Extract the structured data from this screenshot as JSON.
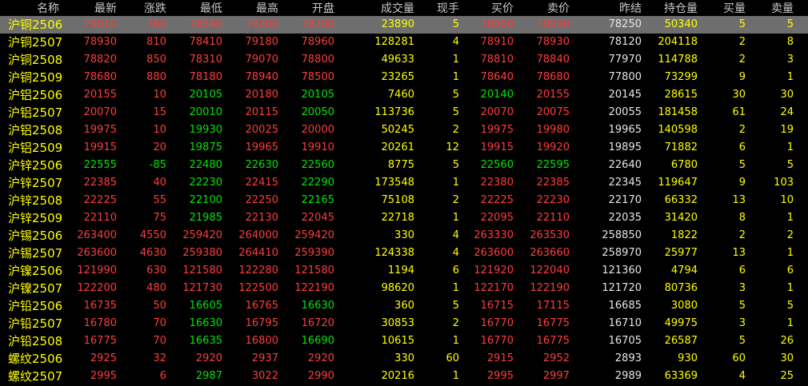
{
  "columns": [
    "名称",
    "最新",
    "涨跌",
    "最低",
    "最高",
    "开盘",
    "成交量",
    "现手",
    "买价",
    "卖价",
    "昨结",
    "持仓量",
    "买量",
    "卖量"
  ],
  "colors": {
    "up": "#ff3c3c",
    "down": "#00e600",
    "yellow": "#ffff00",
    "white": "#e6e6e6",
    "selected_row": "#6e6e6e"
  },
  "rows": [
    [
      "沪铜2506",
      "79010",
      "760",
      "78540",
      "79200",
      "78700",
      "23890",
      "5",
      "78990",
      "79030",
      "78250",
      "50340",
      "5",
      "5"
    ],
    [
      "沪铜2507",
      "78930",
      "810",
      "78410",
      "79180",
      "78960",
      "128281",
      "4",
      "78910",
      "78930",
      "78120",
      "204118",
      "2",
      "8"
    ],
    [
      "沪铜2508",
      "78820",
      "850",
      "78310",
      "79070",
      "78800",
      "49633",
      "1",
      "78810",
      "78840",
      "77970",
      "114788",
      "2",
      "3"
    ],
    [
      "沪铜2509",
      "78680",
      "880",
      "78180",
      "78940",
      "78500",
      "23265",
      "1",
      "78640",
      "78680",
      "77800",
      "73299",
      "9",
      "1"
    ],
    [
      "沪铝2506",
      "20155",
      "10",
      "20105",
      "20180",
      "20105",
      "7460",
      "5",
      "20140",
      "20155",
      "20145",
      "28615",
      "30",
      "30"
    ],
    [
      "沪铝2507",
      "20070",
      "15",
      "20010",
      "20115",
      "20050",
      "113736",
      "5",
      "20070",
      "20075",
      "20055",
      "181458",
      "61",
      "24"
    ],
    [
      "沪铝2508",
      "19975",
      "10",
      "19930",
      "20025",
      "20000",
      "50245",
      "2",
      "19975",
      "19980",
      "19965",
      "140598",
      "2",
      "19"
    ],
    [
      "沪铝2509",
      "19915",
      "20",
      "19875",
      "19965",
      "19910",
      "20261",
      "12",
      "19915",
      "19920",
      "19895",
      "71882",
      "6",
      "1"
    ],
    [
      "沪锌2506",
      "22555",
      "-85",
      "22480",
      "22630",
      "22560",
      "8775",
      "5",
      "22560",
      "22595",
      "22640",
      "6780",
      "5",
      "5"
    ],
    [
      "沪锌2507",
      "22385",
      "40",
      "22230",
      "22415",
      "22290",
      "173548",
      "1",
      "22380",
      "22385",
      "22345",
      "119647",
      "9",
      "103"
    ],
    [
      "沪锌2508",
      "22225",
      "55",
      "22100",
      "22250",
      "22165",
      "75108",
      "2",
      "22225",
      "22230",
      "22170",
      "66332",
      "13",
      "10"
    ],
    [
      "沪锌2509",
      "22110",
      "75",
      "21985",
      "22130",
      "22045",
      "22718",
      "1",
      "22095",
      "22110",
      "22035",
      "31420",
      "8",
      "1"
    ],
    [
      "沪锡2506",
      "263400",
      "4550",
      "259420",
      "264000",
      "259420",
      "330",
      "4",
      "263330",
      "263530",
      "258850",
      "1822",
      "2",
      "2"
    ],
    [
      "沪锡2507",
      "263600",
      "4630",
      "259380",
      "264410",
      "259390",
      "124338",
      "4",
      "263600",
      "263660",
      "258970",
      "25977",
      "13",
      "1"
    ],
    [
      "沪镍2506",
      "121990",
      "630",
      "121580",
      "122280",
      "121580",
      "1194",
      "6",
      "121920",
      "122040",
      "121360",
      "4794",
      "6",
      "6"
    ],
    [
      "沪镍2507",
      "122200",
      "480",
      "121730",
      "122500",
      "122190",
      "98620",
      "1",
      "122170",
      "122190",
      "121720",
      "80736",
      "3",
      "1"
    ],
    [
      "沪铅2506",
      "16735",
      "50",
      "16605",
      "16765",
      "16630",
      "360",
      "5",
      "16715",
      "17115",
      "16685",
      "3080",
      "5",
      "5"
    ],
    [
      "沪铅2507",
      "16780",
      "70",
      "16630",
      "16795",
      "16720",
      "30853",
      "2",
      "16770",
      "16775",
      "16710",
      "49975",
      "3",
      "1"
    ],
    [
      "沪铅2508",
      "16775",
      "70",
      "16635",
      "16800",
      "16690",
      "10615",
      "1",
      "16770",
      "16775",
      "16705",
      "26587",
      "5",
      "26"
    ],
    [
      "螺纹2506",
      "2925",
      "32",
      "2920",
      "2937",
      "2920",
      "330",
      "60",
      "2915",
      "2952",
      "2893",
      "930",
      "60",
      "30"
    ],
    [
      "螺纹2507",
      "2995",
      "6",
      "2987",
      "3022",
      "2990",
      "20216",
      "1",
      "2995",
      "2997",
      "2989",
      "63369",
      "4",
      "25"
    ]
  ],
  "cell_colors": [
    [
      "yel",
      "up",
      "up",
      "up",
      "up",
      "up",
      "yel",
      "yel",
      "up",
      "up",
      "wht",
      "yel",
      "yel",
      "yel"
    ],
    [
      "yel",
      "up",
      "up",
      "up",
      "up",
      "up",
      "yel",
      "yel",
      "up",
      "up",
      "wht",
      "yel",
      "yel",
      "yel"
    ],
    [
      "yel",
      "up",
      "up",
      "up",
      "up",
      "up",
      "yel",
      "yel",
      "up",
      "up",
      "wht",
      "yel",
      "yel",
      "yel"
    ],
    [
      "yel",
      "up",
      "up",
      "up",
      "up",
      "up",
      "yel",
      "yel",
      "up",
      "up",
      "wht",
      "yel",
      "yel",
      "yel"
    ],
    [
      "yel",
      "up",
      "up",
      "down",
      "up",
      "down",
      "yel",
      "yel",
      "down",
      "up",
      "wht",
      "yel",
      "yel",
      "yel"
    ],
    [
      "yel",
      "up",
      "up",
      "down",
      "up",
      "down",
      "yel",
      "yel",
      "up",
      "up",
      "wht",
      "yel",
      "yel",
      "yel"
    ],
    [
      "yel",
      "up",
      "up",
      "down",
      "up",
      "up",
      "yel",
      "yel",
      "up",
      "up",
      "wht",
      "yel",
      "yel",
      "yel"
    ],
    [
      "yel",
      "up",
      "up",
      "down",
      "up",
      "up",
      "yel",
      "yel",
      "up",
      "up",
      "wht",
      "yel",
      "yel",
      "yel"
    ],
    [
      "yel",
      "down",
      "down",
      "down",
      "down",
      "down",
      "yel",
      "yel",
      "down",
      "down",
      "wht",
      "yel",
      "yel",
      "yel"
    ],
    [
      "yel",
      "up",
      "up",
      "down",
      "up",
      "down",
      "yel",
      "yel",
      "up",
      "up",
      "wht",
      "yel",
      "yel",
      "yel"
    ],
    [
      "yel",
      "up",
      "up",
      "down",
      "up",
      "down",
      "yel",
      "yel",
      "up",
      "up",
      "wht",
      "yel",
      "yel",
      "yel"
    ],
    [
      "yel",
      "up",
      "up",
      "down",
      "up",
      "up",
      "yel",
      "yel",
      "up",
      "up",
      "wht",
      "yel",
      "yel",
      "yel"
    ],
    [
      "yel",
      "up",
      "up",
      "up",
      "up",
      "up",
      "yel",
      "yel",
      "up",
      "up",
      "wht",
      "yel",
      "yel",
      "yel"
    ],
    [
      "yel",
      "up",
      "up",
      "up",
      "up",
      "up",
      "yel",
      "yel",
      "up",
      "up",
      "wht",
      "yel",
      "yel",
      "yel"
    ],
    [
      "yel",
      "up",
      "up",
      "up",
      "up",
      "up",
      "yel",
      "yel",
      "up",
      "up",
      "wht",
      "yel",
      "yel",
      "yel"
    ],
    [
      "yel",
      "up",
      "up",
      "up",
      "up",
      "up",
      "yel",
      "yel",
      "up",
      "up",
      "wht",
      "yel",
      "yel",
      "yel"
    ],
    [
      "yel",
      "up",
      "up",
      "down",
      "up",
      "down",
      "yel",
      "yel",
      "up",
      "up",
      "wht",
      "yel",
      "yel",
      "yel"
    ],
    [
      "yel",
      "up",
      "up",
      "down",
      "up",
      "up",
      "yel",
      "yel",
      "up",
      "up",
      "wht",
      "yel",
      "yel",
      "yel"
    ],
    [
      "yel",
      "up",
      "up",
      "down",
      "up",
      "down",
      "yel",
      "yel",
      "up",
      "up",
      "wht",
      "yel",
      "yel",
      "yel"
    ],
    [
      "yel",
      "up",
      "up",
      "up",
      "up",
      "up",
      "yel",
      "yel",
      "up",
      "up",
      "wht",
      "yel",
      "yel",
      "yel"
    ],
    [
      "yel",
      "up",
      "up",
      "down",
      "up",
      "up",
      "yel",
      "yel",
      "up",
      "up",
      "wht",
      "yel",
      "yel",
      "yel"
    ]
  ],
  "selected_row": 0
}
